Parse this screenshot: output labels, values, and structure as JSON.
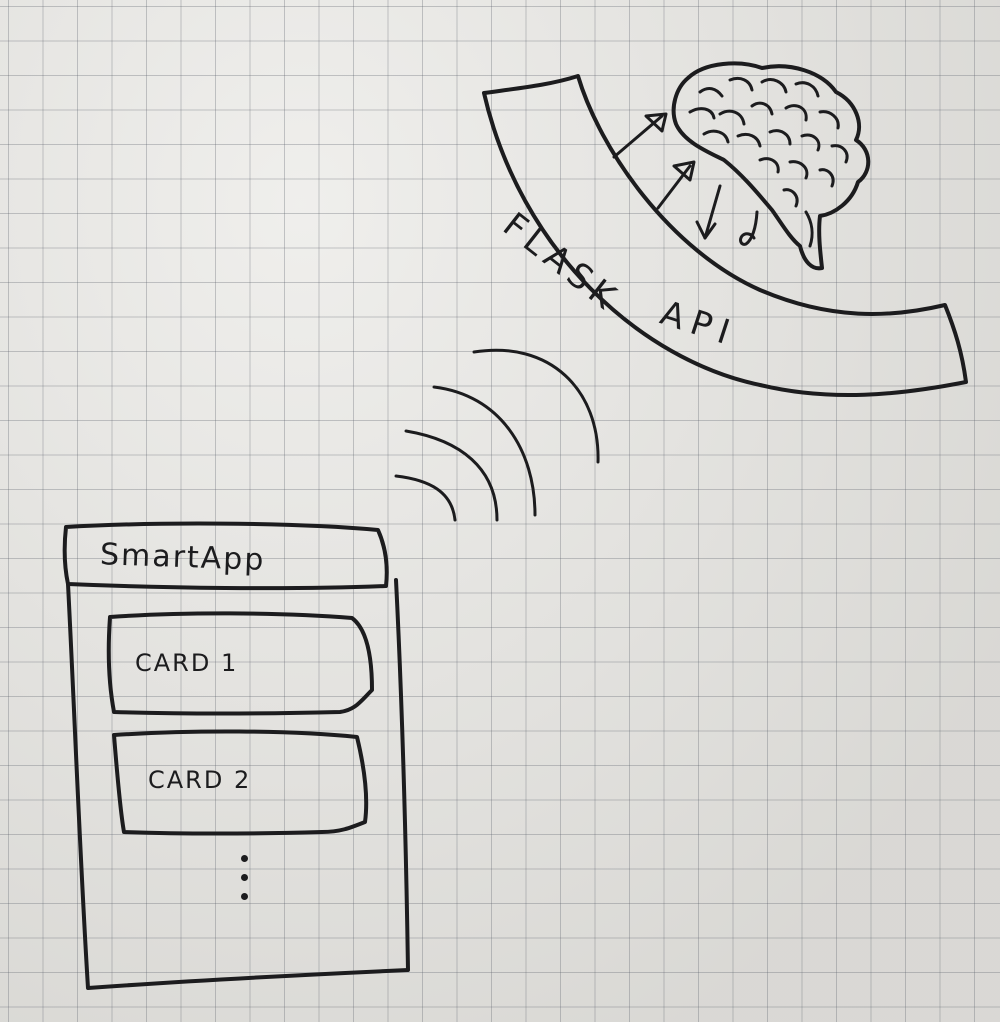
{
  "app": {
    "title": "SmartApp",
    "cards": [
      "CARD 1",
      "CARD 2"
    ]
  },
  "api": {
    "line1": "FLASK",
    "line2": "API"
  }
}
